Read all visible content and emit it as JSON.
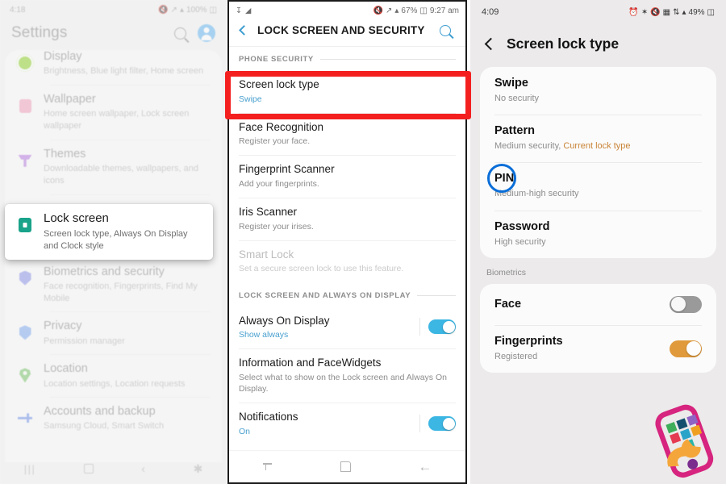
{
  "panel1": {
    "name": "Settings app main list",
    "statusbar": {
      "time": "4:18",
      "battery": "100%",
      "icons": [
        "mute-icon",
        "wifi-icon",
        "signal-icon",
        "battery-icon"
      ]
    },
    "header": {
      "title": "Settings",
      "search_icon": "search-icon",
      "account_icon": "account-avatar-icon"
    },
    "items": [
      {
        "title": "Display",
        "subtitle": "Brightness, Blue light filter, Home screen",
        "icon": "display-icon"
      },
      {
        "title": "Wallpaper",
        "subtitle": "Home screen wallpaper, Lock screen wallpaper",
        "icon": "wallpaper-icon"
      },
      {
        "title": "Themes",
        "subtitle": "Downloadable themes, wallpapers, and icons",
        "icon": "themes-icon"
      },
      {
        "title": "Lock screen",
        "subtitle": "Screen lock type, Always On Display and Clock style",
        "icon": "lock-icon"
      },
      {
        "title": "Biometrics and security",
        "subtitle": "Face recognition, Fingerprints, Find My Mobile",
        "icon": "shield-icon"
      },
      {
        "title": "Privacy",
        "subtitle": "Permission manager",
        "icon": "privacy-icon"
      },
      {
        "title": "Location",
        "subtitle": "Location settings, Location requests",
        "icon": "location-pin-icon"
      },
      {
        "title": "Accounts and backup",
        "subtitle": "Samsung Cloud, Smart Switch",
        "icon": "key-icon"
      }
    ],
    "callout": {
      "title": "Lock screen",
      "subtitle": "Screen lock type, Always On Display and Clock style",
      "icon": "lock-icon"
    },
    "navbar": {
      "recents": "|||",
      "home": "home-icon",
      "back": "‹",
      "accessibility": "✱"
    }
  },
  "panel2": {
    "name": "Lock screen and security settings",
    "statusbar": {
      "left_icons": [
        "download-icon",
        "camera-icon"
      ],
      "right": "67%",
      "time": "9:27 am",
      "icons": [
        "mute-icon",
        "wifi-icon",
        "signal-icon",
        "battery-icon"
      ]
    },
    "header": {
      "back_icon": "chevron-left-icon",
      "title": "LOCK SCREEN AND SECURITY",
      "search_icon": "search-icon"
    },
    "section1_label": "PHONE SECURITY",
    "section1_items": [
      {
        "title": "Screen lock type",
        "subtitle": "Swipe",
        "subtitle_style": "link",
        "highlighted": true
      },
      {
        "title": "Face Recognition",
        "subtitle": "Register your face.",
        "highlighted": false
      },
      {
        "title": "Fingerprint Scanner",
        "subtitle": "Add your fingerprints.",
        "highlighted": false
      },
      {
        "title": "Iris Scanner",
        "subtitle": "Register your irises.",
        "highlighted": false
      },
      {
        "title": "Smart Lock",
        "subtitle": "Set a secure screen lock to use this feature.",
        "disabled": true
      }
    ],
    "section2_label": "LOCK SCREEN AND ALWAYS ON DISPLAY",
    "section2_items": [
      {
        "title": "Always On Display",
        "subtitle": "Show always",
        "subtitle_style": "link",
        "toggle": "on"
      },
      {
        "title": "Information and FaceWidgets",
        "subtitle": "Select what to show on the Lock screen and Always On Display.",
        "toggle": "none"
      },
      {
        "title": "Notifications",
        "subtitle": "On",
        "subtitle_style": "link",
        "toggle": "on"
      }
    ],
    "highlight_color": "#f42020",
    "navbar": {
      "recents": "recents-icon",
      "home": "home-icon",
      "back": "back-arrow-icon"
    }
  },
  "panel3": {
    "name": "Screen lock type selection",
    "statusbar": {
      "time": "4:09",
      "battery": "49%",
      "icons": [
        "alarm-icon",
        "bluetooth-icon",
        "mute-icon",
        "nfc-icon",
        "sync-icon",
        "signal-icon",
        "battery-icon"
      ]
    },
    "header": {
      "back_icon": "chevron-left-icon",
      "title": "Screen lock type"
    },
    "lock_types": [
      {
        "title": "Swipe",
        "subtitle": "No security",
        "extra": "",
        "highlighted": false
      },
      {
        "title": "Pattern",
        "subtitle": "Medium security, ",
        "extra": "Current lock type",
        "highlighted": false
      },
      {
        "title": "PIN",
        "subtitle": "Medium-high security",
        "extra": "",
        "highlighted": true
      },
      {
        "title": "Password",
        "subtitle": "High security",
        "extra": "",
        "highlighted": false
      }
    ],
    "biometrics_label": "Biometrics",
    "biometrics": [
      {
        "title": "Face",
        "subtitle": "",
        "toggle": "off"
      },
      {
        "title": "Fingerprints",
        "subtitle": "Registered",
        "toggle": "on-amber"
      }
    ],
    "highlight_color": "#0a6ed8",
    "current_lock_color": "#c98538",
    "watermark_icon": "phone-wrench-logo"
  }
}
